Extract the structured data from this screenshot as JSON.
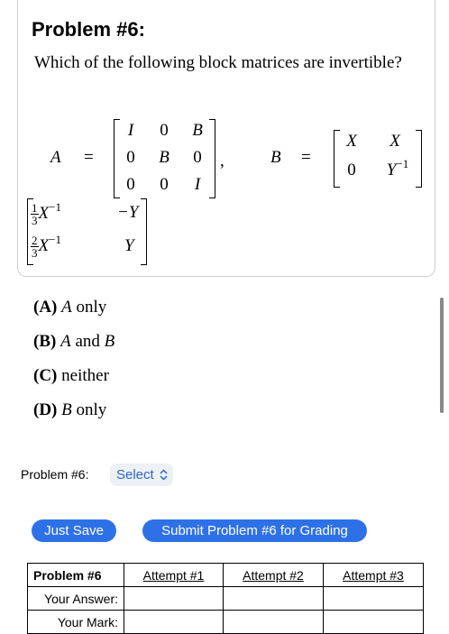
{
  "problem": {
    "title": "Problem #6:",
    "question": "Which of the following block matrices are invertible?"
  },
  "matrices": {
    "A_label": "A",
    "B_label": "B",
    "equals": "=",
    "comma": ",",
    "A_cells": [
      "I",
      "0",
      "B",
      "0",
      "B",
      "0",
      "0",
      "0",
      "I"
    ],
    "B_cells": [
      "X",
      "X",
      "0",
      "Y",
      "−1"
    ],
    "C": {
      "r1c1_num": "1",
      "r1c1_den": "3",
      "r1c1_var": "X",
      "r1c1_exp": "−1",
      "r1c2": "−Y",
      "r2c1_num": "2",
      "r2c1_den": "3",
      "r2c1_var": "X",
      "r2c1_exp": "−1",
      "r2c2": "Y"
    }
  },
  "choices": [
    {
      "letter": "(A)",
      "text_var": "A",
      "text": " only"
    },
    {
      "letter": "(B)",
      "text_var": "A",
      "text_mid": " and ",
      "text_var2": "B"
    },
    {
      "letter": "(C)",
      "text": " neither"
    },
    {
      "letter": "(D)",
      "text_var": "B",
      "text": " only"
    }
  ],
  "answer": {
    "label": "Problem #6:",
    "select_value": "Select",
    "select_icon": "chevron-up-down-icon"
  },
  "buttons": {
    "just_save": "Just Save",
    "submit": "Submit Problem #6 for Grading"
  },
  "attempts_table": {
    "header": [
      "Problem #6",
      "Attempt #1",
      "Attempt #2",
      "Attempt #3"
    ],
    "rows": [
      "Your Answer:",
      "Your Mark:"
    ]
  },
  "colors": {
    "button_bg": "#2e71e6",
    "select_text": "#2c66c8",
    "select_bg": "#edf1f6"
  }
}
